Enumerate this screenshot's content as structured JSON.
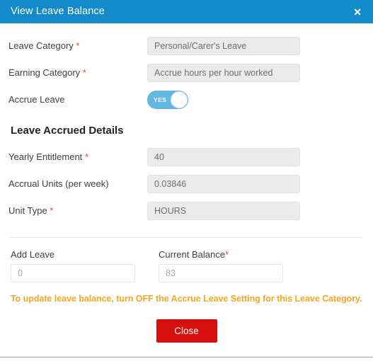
{
  "dialog": {
    "title": "View Leave Balance",
    "close_icon": "close-x-icon"
  },
  "form": {
    "fields": [
      {
        "label": "Leave Category",
        "required_mark": "*",
        "value": "Personal/Carer's Leave"
      },
      {
        "label": "Earning Category",
        "required_mark": "*",
        "value": "Accrue hours per hour worked"
      }
    ],
    "accrue_leave": {
      "label": "Accrue Leave",
      "toggle_state": "YES"
    }
  },
  "accrued_section": {
    "heading": "Leave Accrued Details",
    "fields": [
      {
        "label": "Yearly Entitlement",
        "required_mark": "*",
        "value": "40"
      },
      {
        "label": "Accrual Units (per week)",
        "required_mark": "",
        "value": "0.03846"
      },
      {
        "label": "Unit Type",
        "required_mark": "*",
        "value": "HOURS"
      }
    ]
  },
  "balance_section": {
    "add_leave": {
      "label": "Add Leave",
      "value": "0"
    },
    "current_balance": {
      "label": "Current Balance",
      "required_mark": "*",
      "value": "83"
    },
    "warning": "To update leave balance, turn OFF the Accrue Leave Setting for this Leave Category."
  },
  "footer": {
    "close_button": "Close"
  },
  "colors": {
    "header_blue": "#138bcb",
    "toggle_blue": "#63b8e3",
    "required_red": "#e8483f",
    "warning_orange": "#f5a623",
    "close_button_red": "#d80f0f"
  }
}
